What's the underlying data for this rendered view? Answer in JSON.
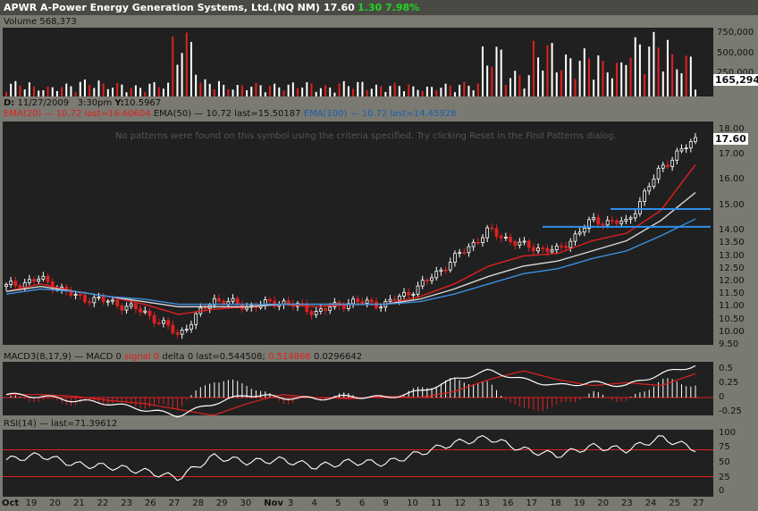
{
  "header": {
    "symbol_title": "APWR A-Power Energy Generation Systems, Ltd.(NQ NM)",
    "last_price": "17.60",
    "change": "1.30",
    "change_pct": "7.98%",
    "volume_label": "Volume 568,373",
    "cursor_info_d": "D:",
    "cursor_date": "11/27/2009",
    "cursor_time": "3:30pm",
    "cursor_y_label": "Y:",
    "cursor_y": "10.5967",
    "ema20_label": "EMA(20)",
    "ema20_value": "10.72 last=16.60604",
    "ema50_label": "EMA(50)",
    "ema50_value": "10.72 last=15.50187",
    "ema100_label": "EMA(100)",
    "ema100_value": "10.72 last=14.45928",
    "pattern_note": "No patterns were found on this symbol using the criteria specified.  Try clicking Reset in the Find Patterns dialog.",
    "macd_label": "MACD3(8,17,9)",
    "macd_part": "MACD 0",
    "macd_signal": "signal 0",
    "macd_delta": "delta 0 last=0.544508;",
    "macd_signal_last": "0.514866",
    "macd_delta_last": "0.0296642",
    "rsi_label": "RSI(14)",
    "rsi_last": "last=71.39612"
  },
  "colors": {
    "up": "#ffffff",
    "down": "#e02020",
    "ema20": "#e02020",
    "ema50": "#d8d8d8",
    "ema100": "#3a8fe0",
    "resistance": "#2f8fe8",
    "change_green": "#1fd61f",
    "panel_bg": "#202020"
  },
  "price_axis": {
    "ticks": [
      "18.00",
      "17.00",
      "16.00",
      "15.00",
      "14.00",
      "13.50",
      "13.00",
      "12.50",
      "12.00",
      "11.50",
      "11.00",
      "10.50",
      "10.00",
      "9.50"
    ],
    "last_tag": "17.60"
  },
  "volume_axis": {
    "ticks": [
      "750,000",
      "500,000",
      "250,000"
    ],
    "last_tag": "165,294"
  },
  "macd_axis": {
    "ticks": [
      "0.5",
      "0.25",
      "0",
      "-0.25"
    ]
  },
  "rsi_axis": {
    "ticks": [
      "100",
      "75",
      "50",
      "25",
      "0"
    ]
  },
  "x_axis": {
    "labels": [
      "Oct",
      "19",
      "20",
      "21",
      "22",
      "23",
      "26",
      "27",
      "28",
      "29",
      "30",
      "Nov",
      "3",
      "4",
      "5",
      "6",
      "9",
      "10",
      "11",
      "12",
      "13",
      "16",
      "17",
      "18",
      "19",
      "20",
      "23",
      "24",
      "25",
      "27"
    ]
  },
  "chart_data": [
    {
      "type": "line",
      "title": "APWR A-Power Energy Generation Systems, Ltd.(NQ NM)",
      "series": [
        {
          "name": "Price",
          "x": [
            "Oct 19",
            "Oct 21",
            "Oct 23",
            "Oct 26",
            "Oct 28",
            "Oct 29",
            "Oct 30",
            "Nov 3",
            "Nov 5",
            "Nov 9",
            "Nov 11",
            "Nov 13",
            "Nov 16",
            "Nov 17",
            "Nov 18",
            "Nov 19",
            "Nov 20",
            "Nov 23",
            "Nov 24",
            "Nov 25",
            "Nov 27"
          ],
          "values": [
            11.8,
            12.1,
            11.4,
            11.2,
            10.8,
            9.9,
            11.3,
            11.0,
            11.2,
            10.8,
            11.2,
            11.1,
            11.8,
            12.9,
            14.0,
            13.4,
            13.2,
            14.4,
            14.3,
            16.5,
            17.6
          ]
        },
        {
          "name": "EMA(20)",
          "values": [
            11.6,
            11.9,
            11.6,
            11.4,
            11.1,
            10.7,
            10.9,
            11.0,
            11.1,
            11.0,
            11.1,
            11.1,
            11.4,
            11.9,
            12.6,
            13.0,
            13.1,
            13.6,
            13.9,
            14.8,
            16.6
          ]
        },
        {
          "name": "EMA(50)",
          "values": [
            11.6,
            11.8,
            11.6,
            11.4,
            11.2,
            11.0,
            11.0,
            11.0,
            11.1,
            11.1,
            11.1,
            11.1,
            11.3,
            11.7,
            12.2,
            12.6,
            12.8,
            13.2,
            13.6,
            14.4,
            15.5
          ]
        },
        {
          "name": "EMA(100)",
          "values": [
            11.5,
            11.7,
            11.6,
            11.4,
            11.3,
            11.1,
            11.1,
            11.1,
            11.1,
            11.1,
            11.1,
            11.1,
            11.2,
            11.5,
            11.9,
            12.3,
            12.5,
            12.9,
            13.2,
            13.8,
            14.46
          ]
        }
      ],
      "resistance_lines": [
        14.85,
        14.15
      ],
      "ylim": [
        9.5,
        18.3
      ]
    },
    {
      "type": "bar",
      "title": "Volume 568,373",
      "values": [
        180000,
        120000,
        150000,
        200000,
        160000,
        130000,
        170000,
        750000,
        200000,
        140000,
        160000,
        150000,
        170000,
        130000,
        180000,
        140000,
        160000,
        120000,
        150000,
        170000,
        600000,
        300000,
        650000,
        500000,
        560000,
        420000,
        700000,
        750000,
        500000,
        165294
      ],
      "ylim": [
        0,
        800000
      ]
    },
    {
      "type": "line",
      "title": "MACD3(8,17,9)",
      "series": [
        {
          "name": "MACD",
          "values": [
            0.05,
            0.02,
            -0.05,
            -0.1,
            -0.2,
            -0.3,
            -0.1,
            0.05,
            0.0,
            -0.02,
            0.02,
            0.0,
            0.1,
            0.3,
            0.45,
            0.3,
            0.2,
            0.25,
            0.2,
            0.4,
            0.54
          ]
        }
      ],
      "ylim": [
        -0.3,
        0.6
      ]
    },
    {
      "type": "line",
      "title": "RSI(14)",
      "series": [
        {
          "name": "RSI",
          "values": [
            55,
            62,
            48,
            45,
            38,
            28,
            60,
            52,
            55,
            45,
            52,
            50,
            65,
            80,
            88,
            70,
            62,
            75,
            70,
            88,
            71.4
          ]
        }
      ],
      "ylim": [
        0,
        100
      ]
    }
  ]
}
